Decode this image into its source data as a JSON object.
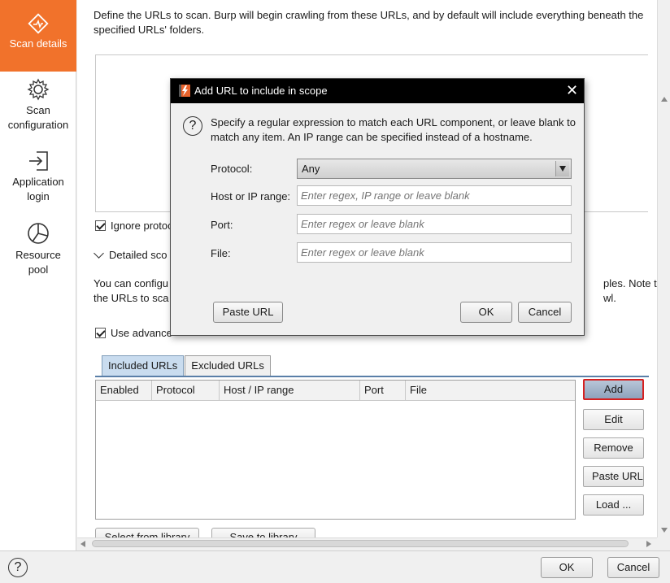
{
  "sidebar": {
    "items": [
      {
        "label_line1": "Scan details",
        "label_line2": "",
        "icon": "scan-details-icon",
        "active": true
      },
      {
        "label_line1": "Scan",
        "label_line2": "configuration",
        "icon": "gear-icon",
        "active": false
      },
      {
        "label_line1": "Application",
        "label_line2": "login",
        "icon": "login-icon",
        "active": false
      },
      {
        "label_line1": "Resource",
        "label_line2": "pool",
        "icon": "pie-chart-icon",
        "active": false
      }
    ]
  },
  "main": {
    "description": "Define the URLs to scan. Burp will begin crawling from these URLs, and by default will include everything beneath the specified URLs' folders.",
    "ignore_protocol_label": "Ignore protoco",
    "detailed_scope_label": "Detailed sco",
    "para2_left_line1": "You can configu",
    "para2_left_line2": "the URLs to sca",
    "para2_right_line1": "ples. Note th",
    "para2_right_line2": "wl.",
    "use_advanced_label": "Use advance",
    "tabs": [
      {
        "label": "Included URLs",
        "active": true
      },
      {
        "label": "Excluded URLs",
        "active": false
      }
    ],
    "table_headers": [
      "Enabled",
      "Protocol",
      "Host / IP range",
      "Port",
      "File"
    ],
    "side_buttons": {
      "add": "Add",
      "edit": "Edit",
      "remove": "Remove",
      "paste_url": "Paste URL",
      "load": "Load ..."
    },
    "library_buttons": {
      "select": "Select from library",
      "save": "Save to library"
    }
  },
  "footer": {
    "help": "?",
    "ok": "OK",
    "cancel": "Cancel"
  },
  "dialog": {
    "title": "Add URL to include in scope",
    "close": "✕",
    "help": "?",
    "message": "Specify a regular expression to match each URL component, or leave blank to match any item. An IP range can be specified instead of a hostname.",
    "protocol_label": "Protocol:",
    "protocol_value": "Any",
    "host_label": "Host or IP range:",
    "host_placeholder": "Enter regex, IP range or leave blank",
    "port_label": "Port:",
    "port_placeholder": "Enter regex or leave blank",
    "file_label": "File:",
    "file_placeholder": "Enter regex or leave blank",
    "paste_url": "Paste URL",
    "ok": "OK",
    "cancel": "Cancel"
  },
  "colors": {
    "accent": "#f1722b",
    "add_button_highlight": "#d62020",
    "active_tab": "#c9dcef"
  }
}
